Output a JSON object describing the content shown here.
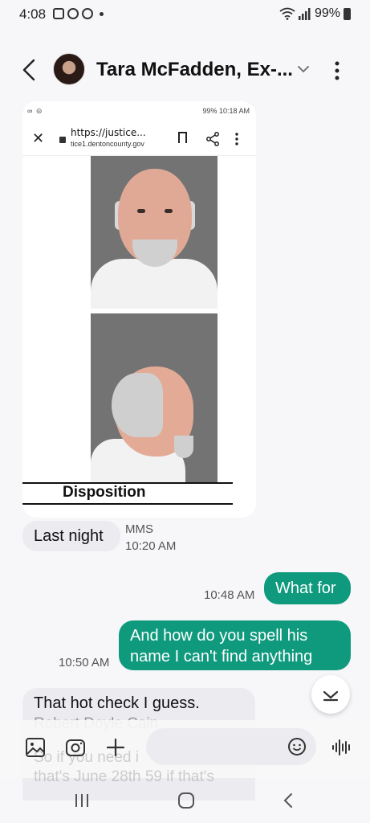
{
  "status_bar": {
    "time": "4:08",
    "battery": "99%"
  },
  "header": {
    "contact_name": "Tara McFadden, Ex-..."
  },
  "mms_image": {
    "status_bar_text": "99% 10:18 AM",
    "url_line1": "https://justice...",
    "url_line2": "tice1.dentoncounty.gov",
    "section_label": "Disposition"
  },
  "messages": [
    {
      "direction": "incoming",
      "text": "Last night",
      "type_label": "MMS",
      "time": "10:20 AM"
    },
    {
      "direction": "outgoing",
      "text": "What for",
      "time": "10:48 AM"
    },
    {
      "direction": "outgoing",
      "line1": "And how do you spell his",
      "line2": "name I can't find anything",
      "time": "10:50 AM"
    },
    {
      "direction": "incoming",
      "line1": "That hot check I guess.",
      "line2": "Robert Doyle Cain",
      "line3": "So if you need i",
      "line4": "that's June 28th 59 if that's"
    }
  ],
  "colors": {
    "outgoing_bubble": "#0f9a7e",
    "incoming_bubble": "#ececf0",
    "background": "#f7f7f9"
  }
}
